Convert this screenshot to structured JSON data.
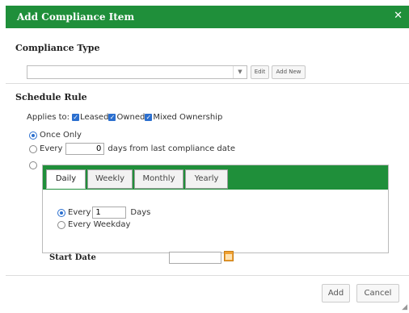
{
  "dialog": {
    "title": "Add Compliance Item",
    "close_glyph": "✕"
  },
  "compliance_type": {
    "heading": "Compliance Type",
    "selected_value": "",
    "edit_label": "Edit",
    "add_new_label": "Add New"
  },
  "schedule_rule": {
    "heading": "Schedule Rule",
    "applies_to_label": "Applies to:",
    "applies_options": [
      {
        "label": "Leased",
        "checked": true
      },
      {
        "label": "Owned",
        "checked": true
      },
      {
        "label": "Mixed Ownership",
        "checked": true
      }
    ],
    "once_only_label": "Once Only",
    "every_label": "Every",
    "every_days_value": "0",
    "every_suffix": "days from last compliance date"
  },
  "recurrence": {
    "tabs": [
      {
        "label": "Daily",
        "active": true
      },
      {
        "label": "Weekly",
        "active": false
      },
      {
        "label": "Monthly",
        "active": false
      },
      {
        "label": "Yearly",
        "active": false
      }
    ],
    "every_label": "Every",
    "every_value": "1",
    "days_label": "Days",
    "every_weekday_label": "Every Weekday"
  },
  "start_date": {
    "label": "Start Date",
    "value": ""
  },
  "footer": {
    "add_label": "Add",
    "cancel_label": "Cancel"
  },
  "colors": {
    "header_green": "#1f8f3a",
    "accent_blue": "#2b6fcf",
    "calendar_orange": "#f0a030"
  }
}
